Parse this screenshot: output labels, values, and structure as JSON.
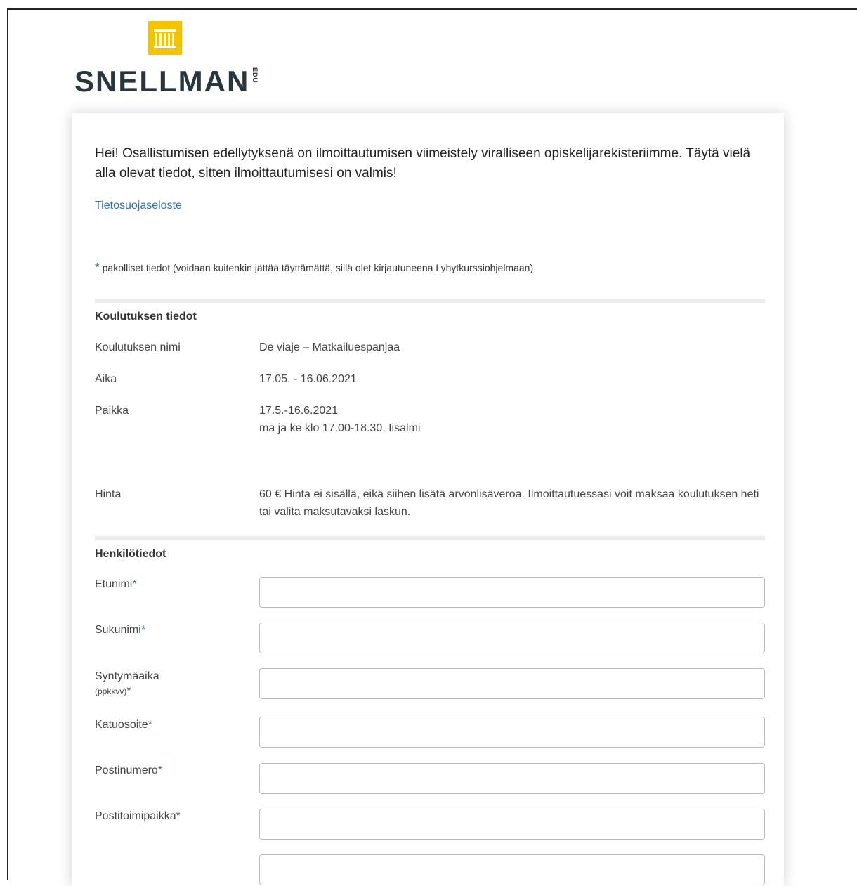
{
  "logo": {
    "text": "SNELLMAN",
    "suffix": "EDU",
    "brand_color": "#f5c400",
    "icon": "pillared-building-icon"
  },
  "intro": {
    "text": "Hei! Osallistumisen edellytyksenä on ilmoittautumisen viimeistely viralliseen opiskelijarekisteriimme. Täytä vielä alla olevat tiedot, sitten ilmoittautumisesi on valmis!"
  },
  "privacy_link": "Tietosuojaseloste",
  "required_note": {
    "star": "*",
    "text": "pakolliset tiedot (voidaan kuitenkin jättää täyttämättä, sillä olet kirjautuneena Lyhytkurssiohjelmaan)"
  },
  "course": {
    "section_title": "Koulutuksen tiedot",
    "name_label": "Koulutuksen nimi",
    "name_value": "De viaje – Matkailuespanjaa",
    "time_label": "Aika",
    "time_value": "17.05. - 16.06.2021",
    "place_label": "Paikka",
    "place_line1": "17.5.-16.6.2021",
    "place_line2": "ma ja ke klo 17.00-18.30, Iisalmi",
    "price_label": "Hinta",
    "price_value": "60 € Hinta ei sisällä, eikä siihen lisätä arvonlisäveroa. Ilmoittautuessasi voit maksaa koulutuksen heti tai valita maksutavaksi laskun."
  },
  "personal": {
    "section_title": "Henkilötiedot",
    "star": "*",
    "fields": [
      {
        "label": "Etunimi",
        "value": ""
      },
      {
        "label": "Sukunimi",
        "value": ""
      },
      {
        "label": "Syntymäaika",
        "sub": "(ppkkvv)",
        "value": ""
      },
      {
        "label": "Katuosoite",
        "value": ""
      },
      {
        "label": "Postinumero",
        "value": ""
      },
      {
        "label": "Postitoimipaikka",
        "value": ""
      }
    ]
  },
  "colors": {
    "accent": "#2f6fb5",
    "divider": "#ececec"
  }
}
